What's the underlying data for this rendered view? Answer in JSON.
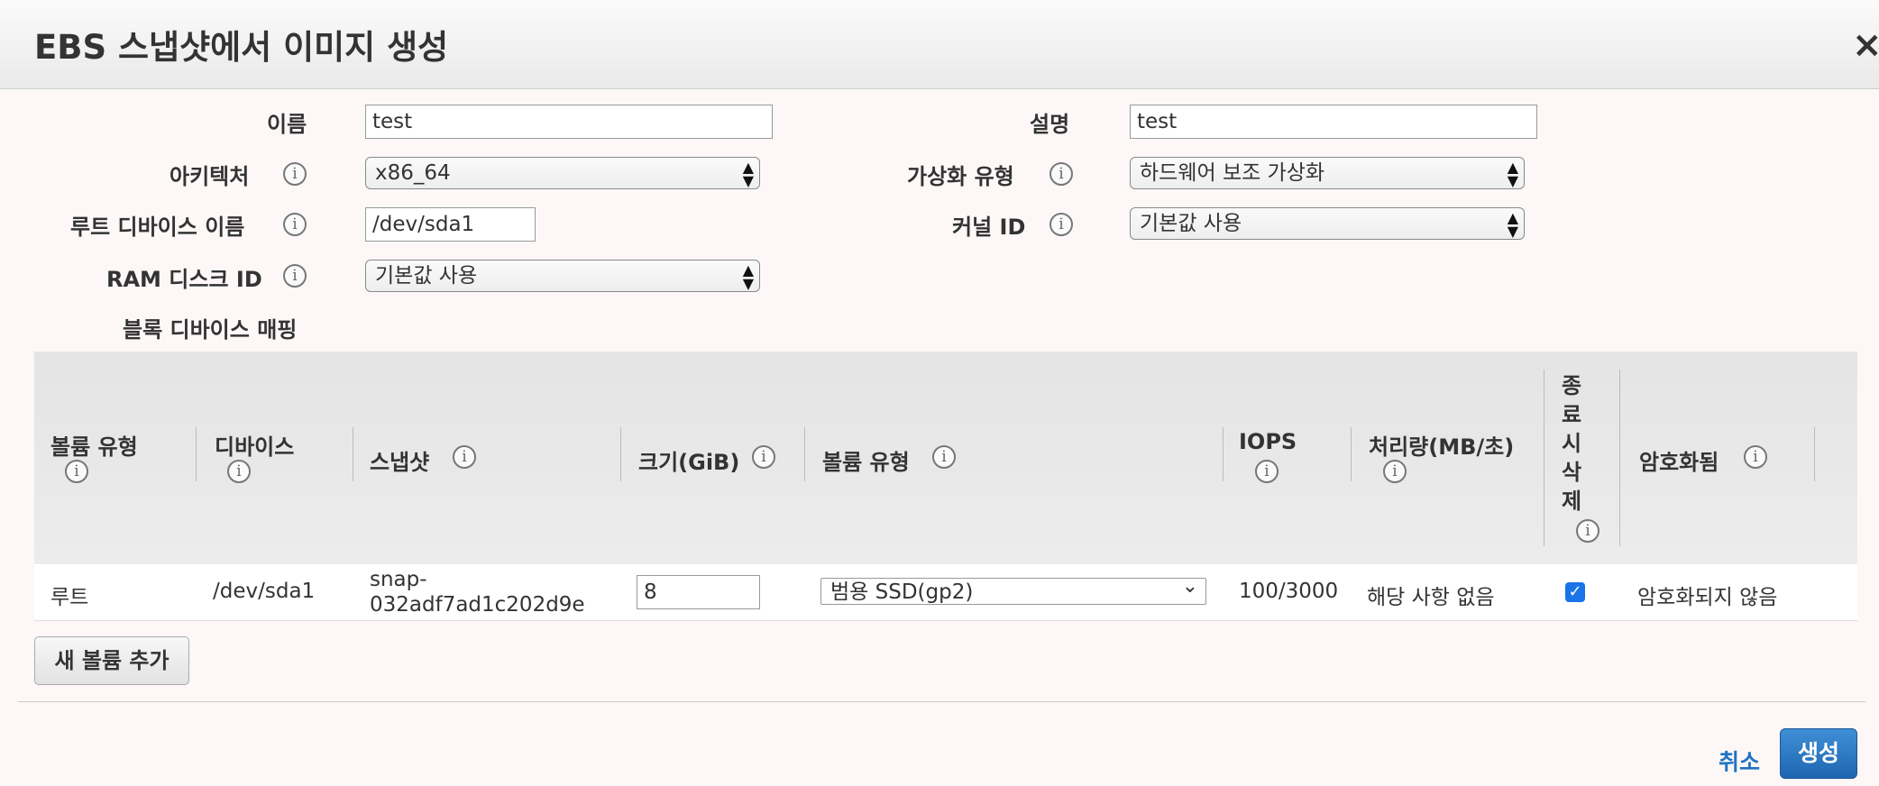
{
  "dialog": {
    "title": "EBS 스냅샷에서 이미지 생성",
    "close_glyph": "×"
  },
  "form": {
    "name_label": "이름",
    "name_value": "test",
    "description_label": "설명",
    "description_value": "test",
    "architecture_label": "아키텍처",
    "architecture_value": "x86_64",
    "virtualization_label": "가상화 유형",
    "virtualization_value": "하드웨어 보조 가상화",
    "root_device_label": "루트 디바이스 이름",
    "root_device_value": "/dev/sda1",
    "kernel_label": "커널 ID",
    "kernel_value": "기본값 사용",
    "ramdisk_label": "RAM 디스크 ID",
    "ramdisk_value": "기본값 사용",
    "block_mapping_label": "블록 디바이스 매핑"
  },
  "table": {
    "headers": {
      "volume_type_l1": "볼륨 유형",
      "device_l1": "디바이스",
      "snapshot": "스냅샷",
      "size": "크기(GiB)",
      "volume_type2": "볼륨 유형",
      "iops_l1": "IOPS",
      "throughput_l1": "처리량(MB/초)",
      "delete_chars": [
        "종",
        "료",
        "시",
        "삭",
        "제"
      ],
      "encrypted": "암호화됨"
    },
    "row": {
      "volume_type": "루트",
      "device": "/dev/sda1",
      "snapshot_l1": "snap-",
      "snapshot_l2": "032adf7ad1c202d9e",
      "size": "8",
      "volume_type2": "범용 SSD(gp2)",
      "iops": "100/3000",
      "throughput": "해당 사항 없음",
      "delete_on_termination": true,
      "encrypted": "암호화되지 않음"
    }
  },
  "buttons": {
    "add_volume": "새 볼륨 추가",
    "cancel": "취소",
    "create": "생성"
  },
  "icons": {
    "info": "i",
    "select_arrows": "▲▼",
    "dropdown_chevron": "⌄",
    "check": "✓"
  },
  "colors": {
    "primary": "#1f66b1",
    "link": "#1f73c1",
    "checkbox": "#1a73e8"
  }
}
